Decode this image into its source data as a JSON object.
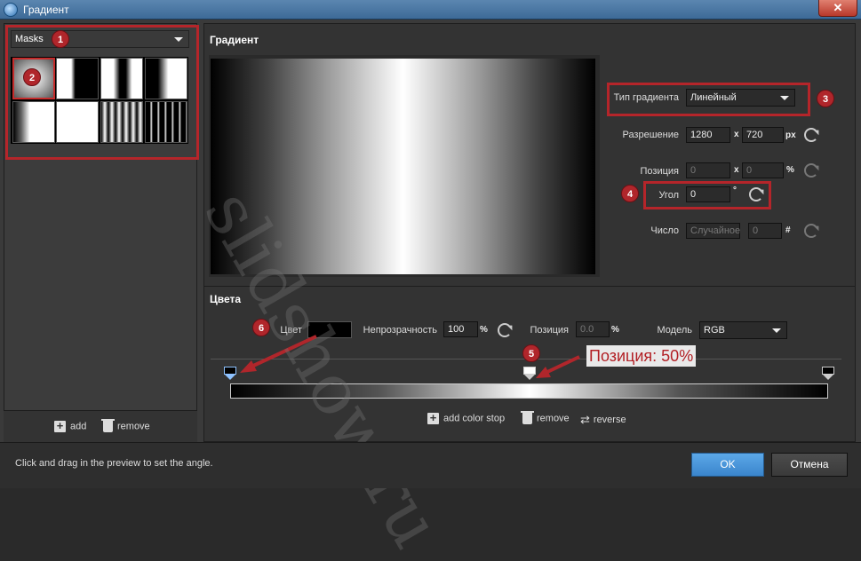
{
  "window": {
    "title": "Градиент",
    "close_label": "✕"
  },
  "left": {
    "masks_select": "Masks",
    "add_label": "add",
    "remove_label": "remove"
  },
  "gradient_section": {
    "title": "Градиент",
    "type_label": "Тип градиента",
    "type_value": "Линейный",
    "resolution_label": "Разрешение",
    "res_w": "1280",
    "res_x": "x",
    "res_h": "720",
    "res_unit": "px",
    "position_label": "Позиция",
    "pos_x": "0",
    "pos_sep": "x",
    "pos_y": "0",
    "pos_unit": "%",
    "angle_label": "Угол",
    "angle_value": "0",
    "angle_unit": "°",
    "seed_label": "Число",
    "seed_random": "Случайное",
    "seed_value": "0",
    "seed_unit": "#"
  },
  "colors_section": {
    "title": "Цвета",
    "color_label": "Цвет",
    "opacity_label": "Непрозрачность",
    "opacity_value": "100",
    "opacity_unit": "%",
    "position_label": "Позиция",
    "position_value": "0.0",
    "position_unit": "%",
    "model_label": "Модель",
    "model_value": "RGB",
    "add_stop_label": "add color stop",
    "remove_label": "remove",
    "reverse_label": "reverse"
  },
  "annotations": {
    "b1": "1",
    "b2": "2",
    "b3": "3",
    "b4": "4",
    "b5": "5",
    "b6": "6",
    "callout": "Позиция: 50%",
    "watermark": "slidshow.ru"
  },
  "footer": {
    "hint": "Click and drag in the preview to set the angle.",
    "ok_label": "OK",
    "cancel_label": "Отмена"
  },
  "colors": {
    "accent_red": "#b0262b",
    "ok_blue": "#3a85cc"
  }
}
